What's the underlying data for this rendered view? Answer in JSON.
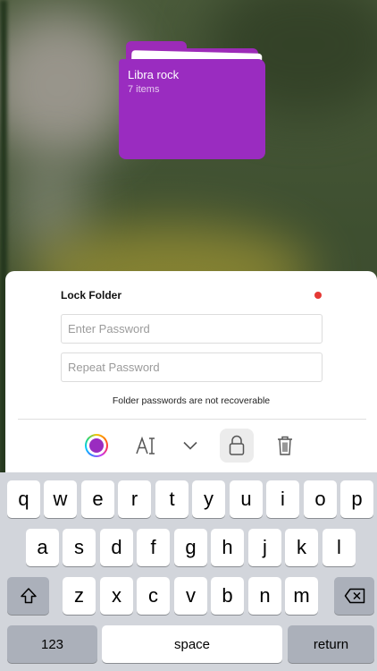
{
  "folder": {
    "name": "Libra rock",
    "item_count": "7 items",
    "color": "#9a2cc0"
  },
  "lock_sheet": {
    "title": "Lock Folder",
    "status_dot_color": "#e53935",
    "password": {
      "value": "",
      "placeholder": "Enter Password"
    },
    "repeat_password": {
      "value": "",
      "placeholder": "Repeat Password"
    },
    "note": "Folder passwords are not recoverable",
    "toolbar_icons": [
      "color-picker-icon",
      "font-icon",
      "chevron-down-icon",
      "lock-icon",
      "trash-icon"
    ]
  },
  "keyboard": {
    "row1": [
      "q",
      "w",
      "e",
      "r",
      "t",
      "y",
      "u",
      "i",
      "o",
      "p"
    ],
    "row2": [
      "a",
      "s",
      "d",
      "f",
      "g",
      "h",
      "j",
      "k",
      "l"
    ],
    "row3": [
      "z",
      "x",
      "c",
      "v",
      "b",
      "n",
      "m"
    ],
    "shift_icon": "shift-icon",
    "delete_icon": "backspace-icon",
    "numbers_label": "123",
    "space_label": "space",
    "return_label": "return"
  }
}
